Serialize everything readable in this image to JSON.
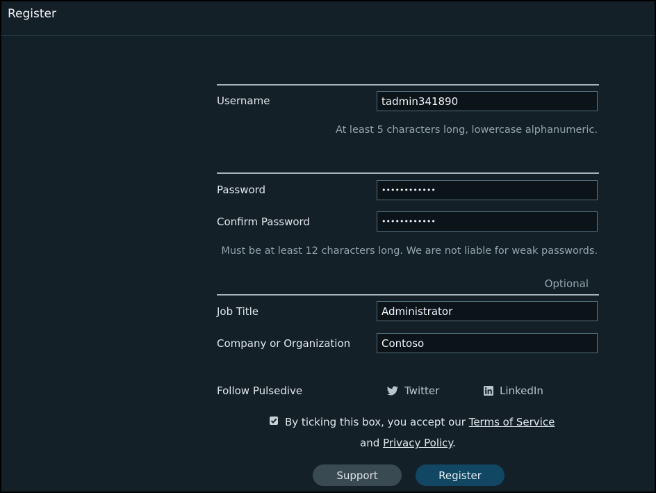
{
  "page": {
    "title": "Register"
  },
  "account": {
    "username_label": "Username",
    "username_value": "tadmin341890",
    "username_hint": "At least 5 characters long, lowercase alphanumeric."
  },
  "security": {
    "password_label": "Password",
    "password_value": "••••••••••••",
    "confirm_label": "Confirm Password",
    "confirm_value": "••••••••••••",
    "password_hint": "Must be at least 12 characters long. We are not liable for weak passwords."
  },
  "optional": {
    "heading": "Optional",
    "job_title_label": "Job Title",
    "job_title_value": "Administrator",
    "company_label": "Company or Organization",
    "company_value": "Contoso"
  },
  "follow": {
    "label": "Follow Pulsedive",
    "twitter": "Twitter",
    "linkedin": "LinkedIn",
    "icons": [
      "twitter-icon",
      "linkedin-icon"
    ]
  },
  "consent": {
    "checked": true,
    "text_before": "By ticking this box, you accept our",
    "terms_link": "Terms of Service",
    "and": "and",
    "privacy_link": "Privacy Policy",
    "period": "."
  },
  "actions": {
    "support_label": "Support",
    "register_label": "Register"
  },
  "colors": {
    "background": "#142028",
    "accent_button": "#114763",
    "secondary_button": "#3a4a52"
  }
}
